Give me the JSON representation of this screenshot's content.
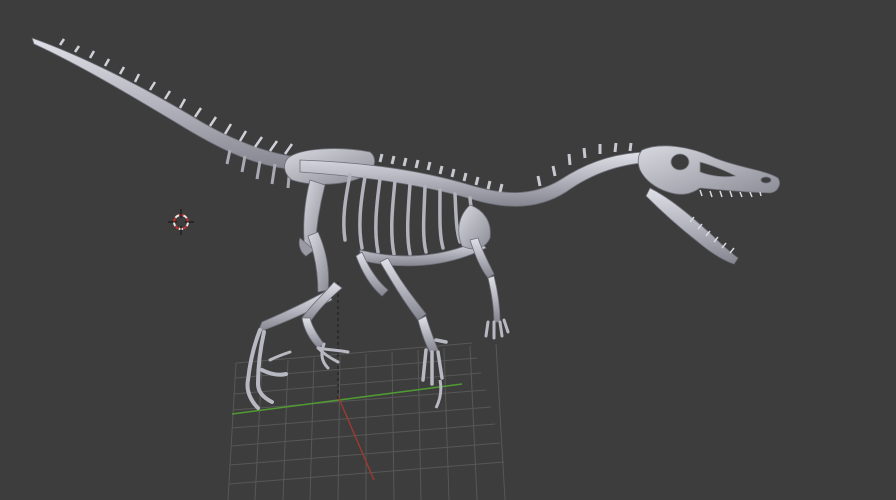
{
  "viewport": {
    "background": "#3d3d3d",
    "grid_color": "#5a5a5a",
    "x_axis_color": "#5ea53a",
    "y_axis_color": "#a8403a",
    "bone_color": "#b9b9c3",
    "bone_shadow": "#8e8e99",
    "bone_highlight": "#e2e2ea"
  },
  "objects": {
    "model": "velociraptor-skeleton",
    "cursor_icon": "3d-cursor-icon"
  }
}
